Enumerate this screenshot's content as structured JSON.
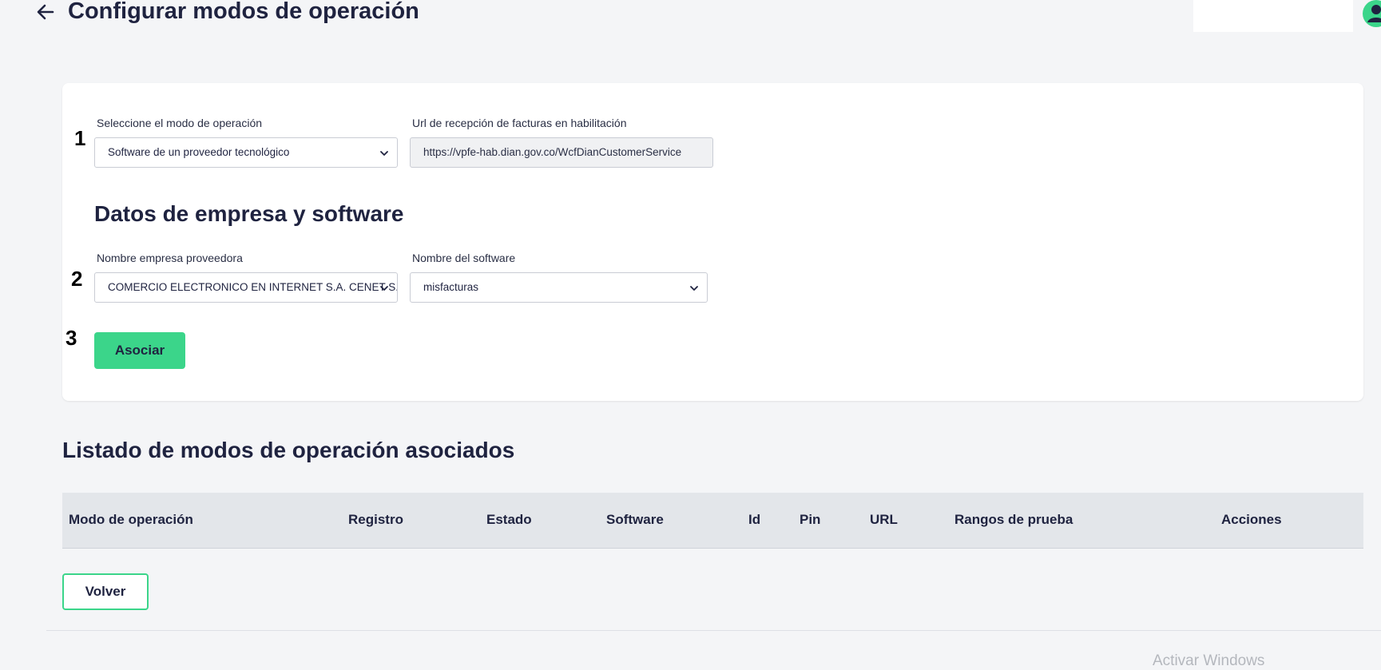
{
  "header": {
    "title": "Configurar modos de operación",
    "back_icon": "arrow-left-icon",
    "avatar_icon": "user-icon"
  },
  "form": {
    "steps": [
      "1",
      "2",
      "3"
    ],
    "mode_label": "Seleccione el modo de operación",
    "mode_value": "Software de un proveedor tecnológico",
    "url_label": "Url de recepción de facturas en habilitación",
    "url_value": "https://vpfe-hab.dian.gov.co/WcfDianCustomerService",
    "section_title": "Datos de empresa y software",
    "provider_label": "Nombre empresa proveedora",
    "provider_value": "COMERCIO ELECTRONICO EN INTERNET S.A. CENET S.A.",
    "software_label": "Nombre del software",
    "software_value": "misfacturas",
    "associate_button": "Asociar"
  },
  "list": {
    "title": "Listado de modos de operación asociados",
    "columns": [
      "Modo de operación",
      "Registro",
      "Estado",
      "Software",
      "Id",
      "Pin",
      "URL",
      "Rangos de prueba",
      "Acciones"
    ],
    "rows": []
  },
  "footer": {
    "back_button": "Volver"
  },
  "os_watermark": "Activar Windows",
  "colors": {
    "accent": "#3bd58a",
    "text": "#1f2340",
    "background": "#f4f5f7"
  }
}
